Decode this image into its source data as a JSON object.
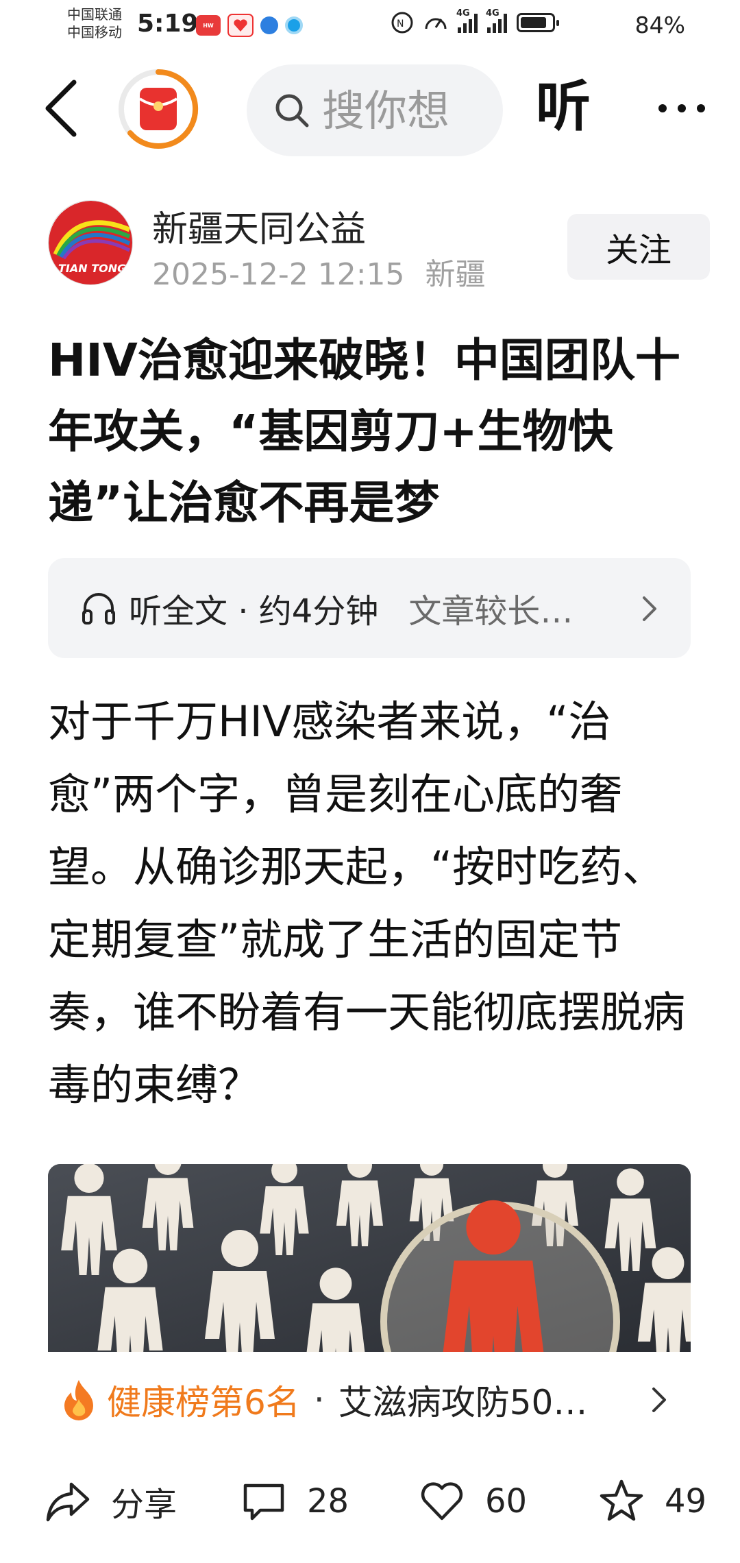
{
  "status_bar": {
    "carrier_1": "中国联通",
    "carrier_2": "中国移动",
    "time": "5:19",
    "network_1": "4G",
    "network_2": "4G",
    "battery_percent": "84%",
    "battery_level": 0.84,
    "app_icons": [
      "huawei-app-icon",
      "heart-app-icon",
      "globe-app-icon",
      "browser-app-icon"
    ]
  },
  "nav": {
    "search_placeholder": "搜你想",
    "listen_label": "听",
    "accent_color": "#f28a1c"
  },
  "author": {
    "name": "新疆天同公益",
    "datetime": "2025-12-2  12:15",
    "location": "新疆",
    "avatar_text": "TIAN TONG",
    "follow_label": "关注"
  },
  "article": {
    "title": "HIV治愈迎来破晓！中国团队十年攻关，“基因剪刀+生物快递”让治愈不再是梦",
    "listen_label": "听全文 · 约4分钟",
    "listen_desc": "文章较长…",
    "body": "对于千万HIV感染者来说，“治愈”两个字，曾是刻在心底的奢望。从确诊那天起，“按时吃药、定期复查”就成了生活的固定节奏，谁不盼着有一天能彻底摆脱病毒的束缚？"
  },
  "ranking": {
    "label": "健康榜第6名",
    "separator": "·",
    "topic": "艾滋病攻防50…",
    "label_color": "#f07a1c"
  },
  "actions": {
    "share_label": "分享",
    "comments": "28",
    "likes": "60",
    "favorites": "49"
  }
}
